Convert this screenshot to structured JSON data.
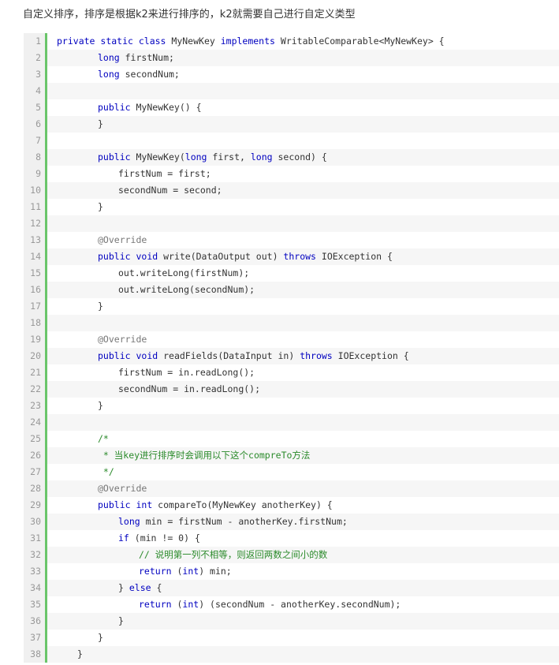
{
  "intro": "自定义排序，排序是根据k2来进行排序的，k2就需要自己进行自定义类型",
  "colors": {
    "keyword": "#0000c0",
    "comment": "#2a8a2a",
    "gutter_border": "#6ac56a"
  },
  "code": {
    "language": "java",
    "lines": [
      {
        "n": "1",
        "indent": 0,
        "t": [
          [
            "kw",
            "private "
          ],
          [
            "kw",
            "static "
          ],
          [
            "kw",
            "class "
          ],
          [
            "",
            "MyNewKey "
          ],
          [
            "kw",
            "implements "
          ],
          [
            "",
            "WritableComparable<MyNewKey> {"
          ]
        ]
      },
      {
        "n": "2",
        "indent": 8,
        "t": [
          [
            "kw",
            "long "
          ],
          [
            "",
            "firstNum;"
          ]
        ]
      },
      {
        "n": "3",
        "indent": 8,
        "t": [
          [
            "kw",
            "long "
          ],
          [
            "",
            "secondNum;"
          ]
        ]
      },
      {
        "n": "4",
        "indent": 0,
        "t": []
      },
      {
        "n": "5",
        "indent": 8,
        "t": [
          [
            "kw",
            "public "
          ],
          [
            "",
            "MyNewKey() {"
          ]
        ]
      },
      {
        "n": "6",
        "indent": 8,
        "t": [
          [
            "",
            "}"
          ]
        ]
      },
      {
        "n": "7",
        "indent": 0,
        "t": []
      },
      {
        "n": "8",
        "indent": 8,
        "t": [
          [
            "kw",
            "public "
          ],
          [
            "",
            "MyNewKey("
          ],
          [
            "kw",
            "long "
          ],
          [
            "",
            "first, "
          ],
          [
            "kw",
            "long "
          ],
          [
            "",
            "second) {"
          ]
        ]
      },
      {
        "n": "9",
        "indent": 12,
        "t": [
          [
            "",
            "firstNum = first;"
          ]
        ]
      },
      {
        "n": "10",
        "indent": 12,
        "t": [
          [
            "",
            "secondNum = second;"
          ]
        ]
      },
      {
        "n": "11",
        "indent": 8,
        "t": [
          [
            "",
            "}"
          ]
        ]
      },
      {
        "n": "12",
        "indent": 0,
        "t": []
      },
      {
        "n": "13",
        "indent": 8,
        "t": [
          [
            "ann",
            "@Override"
          ]
        ]
      },
      {
        "n": "14",
        "indent": 8,
        "t": [
          [
            "kw",
            "public "
          ],
          [
            "kw",
            "void "
          ],
          [
            "",
            "write(DataOutput out) "
          ],
          [
            "kw",
            "throws "
          ],
          [
            "",
            "IOException {"
          ]
        ]
      },
      {
        "n": "15",
        "indent": 12,
        "t": [
          [
            "",
            "out.writeLong(firstNum);"
          ]
        ]
      },
      {
        "n": "16",
        "indent": 12,
        "t": [
          [
            "",
            "out.writeLong(secondNum);"
          ]
        ]
      },
      {
        "n": "17",
        "indent": 8,
        "t": [
          [
            "",
            "}"
          ]
        ]
      },
      {
        "n": "18",
        "indent": 0,
        "t": []
      },
      {
        "n": "19",
        "indent": 8,
        "t": [
          [
            "ann",
            "@Override"
          ]
        ]
      },
      {
        "n": "20",
        "indent": 8,
        "t": [
          [
            "kw",
            "public "
          ],
          [
            "kw",
            "void "
          ],
          [
            "",
            "readFields(DataInput in) "
          ],
          [
            "kw",
            "throws "
          ],
          [
            "",
            "IOException {"
          ]
        ]
      },
      {
        "n": "21",
        "indent": 12,
        "t": [
          [
            "",
            "firstNum = in.readLong();"
          ]
        ]
      },
      {
        "n": "22",
        "indent": 12,
        "t": [
          [
            "",
            "secondNum = in.readLong();"
          ]
        ]
      },
      {
        "n": "23",
        "indent": 8,
        "t": [
          [
            "",
            "}"
          ]
        ]
      },
      {
        "n": "24",
        "indent": 0,
        "t": []
      },
      {
        "n": "25",
        "indent": 8,
        "t": [
          [
            "cm",
            "/*"
          ]
        ]
      },
      {
        "n": "26",
        "indent": 8,
        "t": [
          [
            "cm",
            " * 当key进行排序时会调用以下这个compreTo方法"
          ]
        ]
      },
      {
        "n": "27",
        "indent": 8,
        "t": [
          [
            "cm",
            " */"
          ]
        ]
      },
      {
        "n": "28",
        "indent": 8,
        "t": [
          [
            "ann",
            "@Override"
          ]
        ]
      },
      {
        "n": "29",
        "indent": 8,
        "t": [
          [
            "kw",
            "public "
          ],
          [
            "kw",
            "int "
          ],
          [
            "",
            "compareTo(MyNewKey anotherKey) {"
          ]
        ]
      },
      {
        "n": "30",
        "indent": 12,
        "t": [
          [
            "kw",
            "long "
          ],
          [
            "",
            "min = firstNum - anotherKey.firstNum;"
          ]
        ]
      },
      {
        "n": "31",
        "indent": 12,
        "t": [
          [
            "kw",
            "if "
          ],
          [
            "",
            "(min != "
          ],
          [
            "num",
            "0"
          ],
          [
            "",
            ") {"
          ]
        ]
      },
      {
        "n": "32",
        "indent": 16,
        "t": [
          [
            "cm",
            "// 说明第一列不相等，则返回两数之间小的数"
          ]
        ]
      },
      {
        "n": "33",
        "indent": 16,
        "t": [
          [
            "kw",
            "return "
          ],
          [
            "",
            "("
          ],
          [
            "kw",
            "int"
          ],
          [
            "",
            ") min;"
          ]
        ]
      },
      {
        "n": "34",
        "indent": 12,
        "t": [
          [
            "",
            "} "
          ],
          [
            "kw",
            "else "
          ],
          [
            "",
            "{"
          ]
        ]
      },
      {
        "n": "35",
        "indent": 16,
        "t": [
          [
            "kw",
            "return "
          ],
          [
            "",
            "("
          ],
          [
            "kw",
            "int"
          ],
          [
            "",
            ") (secondNum - anotherKey.secondNum);"
          ]
        ]
      },
      {
        "n": "36",
        "indent": 12,
        "t": [
          [
            "",
            "}"
          ]
        ]
      },
      {
        "n": "37",
        "indent": 8,
        "t": [
          [
            "",
            "}"
          ]
        ]
      },
      {
        "n": "38",
        "indent": 4,
        "t": [
          [
            "",
            "}"
          ]
        ]
      }
    ]
  }
}
